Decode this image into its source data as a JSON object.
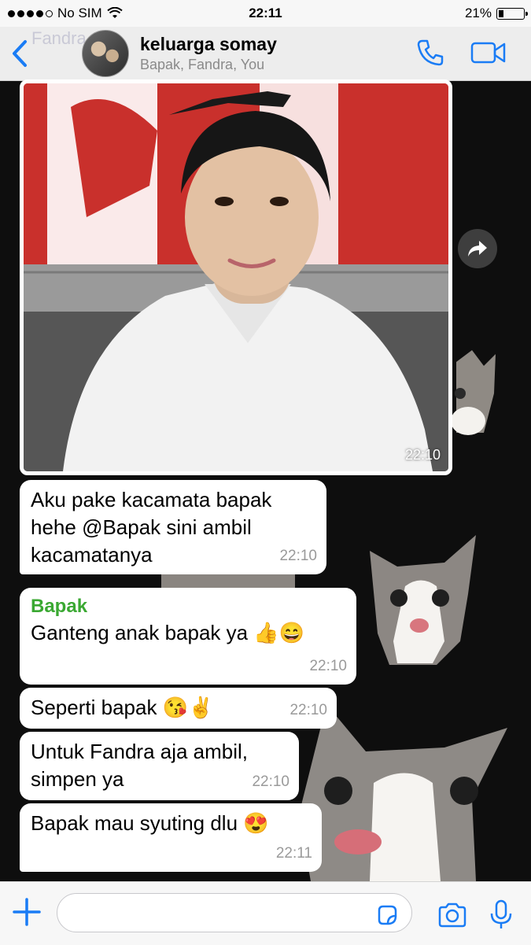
{
  "status_bar": {
    "carrier": "No SIM",
    "time": "22:11",
    "battery": "21%",
    "battery_level": 0.21,
    "signal_bars_filled": 4
  },
  "header": {
    "back_icon": "chevron-left-icon",
    "ghost_name": "Fandra",
    "title": "keluarga somay",
    "subtitle": "Bapak, Fandra, You",
    "call_icon": "phone-icon",
    "video_icon": "video-camera-icon"
  },
  "messages": [
    {
      "type": "image",
      "time": "22:10"
    },
    {
      "type": "text",
      "sender": "",
      "text_lines": [
        "Aku pake kacamata bapak",
        "hehe @Bapak sini ambil",
        "kacamatanya"
      ],
      "time": "22:10"
    },
    {
      "type": "text",
      "sender": "Bapak",
      "text_lines": [
        "Ganteng anak bapak ya 👍😄"
      ],
      "time": "22:10"
    },
    {
      "type": "text",
      "sender": "",
      "text_lines": [
        "Seperti bapak 😘✌️"
      ],
      "time": "22:10"
    },
    {
      "type": "text",
      "sender": "",
      "text_lines": [
        "Untuk Fandra aja ambil,",
        "simpen ya"
      ],
      "time": "22:10"
    },
    {
      "type": "text",
      "sender": "",
      "text_lines": [
        "Bapak mau syuting dlu 😍"
      ],
      "time": "22:11"
    }
  ],
  "forward_icon": "forward-arrow-icon",
  "input_bar": {
    "plus_icon": "plus-icon",
    "input_value": "",
    "sticker_icon": "sticker-icon",
    "camera_icon": "camera-icon",
    "mic_icon": "microphone-icon"
  },
  "colors": {
    "accent": "#1a7cf5",
    "sender_name": "#3aa832",
    "chat_background": "#0e0e0e",
    "bubble": "#ffffff"
  }
}
